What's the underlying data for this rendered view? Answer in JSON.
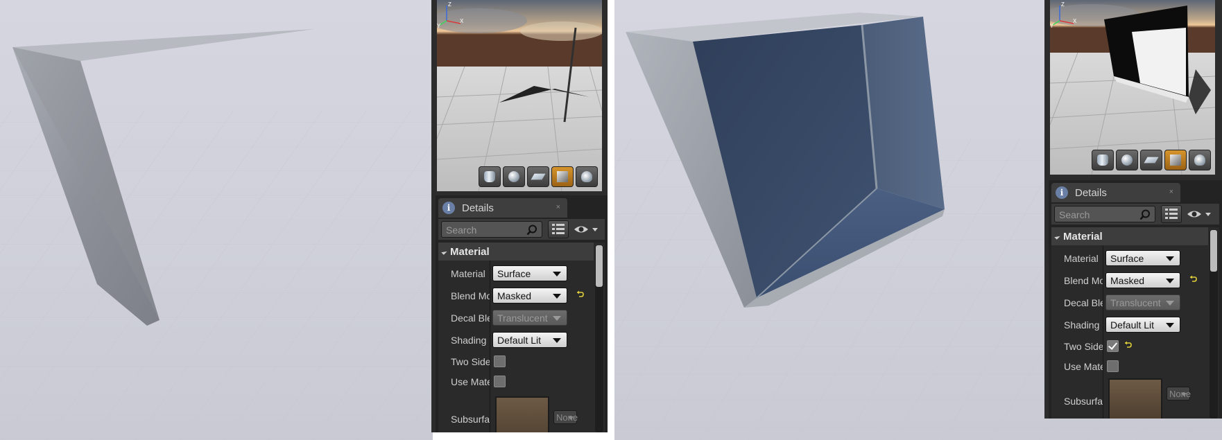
{
  "left_pane": {
    "details": {
      "tab_label": "Details",
      "close_glyph": "×",
      "search_placeholder": "Search",
      "category": "Material",
      "rows": {
        "material": {
          "label": "Material",
          "value": "Surface"
        },
        "blend": {
          "label": "Blend Mode",
          "value": "Masked"
        },
        "decal": {
          "label": "Decal Blend Mode",
          "value": "Translucent"
        },
        "shading": {
          "label": "Shading Model",
          "value": "Default Lit"
        },
        "twosided": {
          "label": "Two Sided",
          "checked": false
        },
        "usemat": {
          "label": "Use Material Attributes",
          "checked": false
        },
        "subsurface": {
          "label": "Subsurface Profile",
          "value": "None"
        }
      }
    }
  },
  "right_pane": {
    "details": {
      "tab_label": "Details",
      "close_glyph": "×",
      "search_placeholder": "Search",
      "category": "Material",
      "rows": {
        "material": {
          "label": "Material",
          "value": "Surface"
        },
        "blend": {
          "label": "Blend Mode",
          "value": "Masked"
        },
        "decal": {
          "label": "Decal Blend Mode",
          "value": "Translucent"
        },
        "shading": {
          "label": "Shading Model",
          "value": "Default Lit"
        },
        "twosided": {
          "label": "Two Sided",
          "checked": true
        },
        "usemat": {
          "label": "Use Material Attributes",
          "checked": false
        },
        "subsurface": {
          "label": "Subsurface Profile",
          "value": "None"
        }
      }
    }
  },
  "preview_toolbar": [
    "cylinder-preview",
    "sphere-preview",
    "plane-preview",
    "cube-preview",
    "teapot-preview"
  ],
  "axis_labels": {
    "z": "Z",
    "x": "X",
    "y": "Y"
  },
  "colors": {
    "panel_bg": "#2c2c2c",
    "active_tool": "#d6952c",
    "reset_arrow": "#e0d03a",
    "viewport_bg": "#d2d3dd"
  },
  "icons": [
    "info-icon",
    "close-icon",
    "search-icon",
    "grid-view-icon",
    "eye-icon",
    "collapse-triangle-icon",
    "reset-to-default-icon",
    "checkmark-icon"
  ]
}
